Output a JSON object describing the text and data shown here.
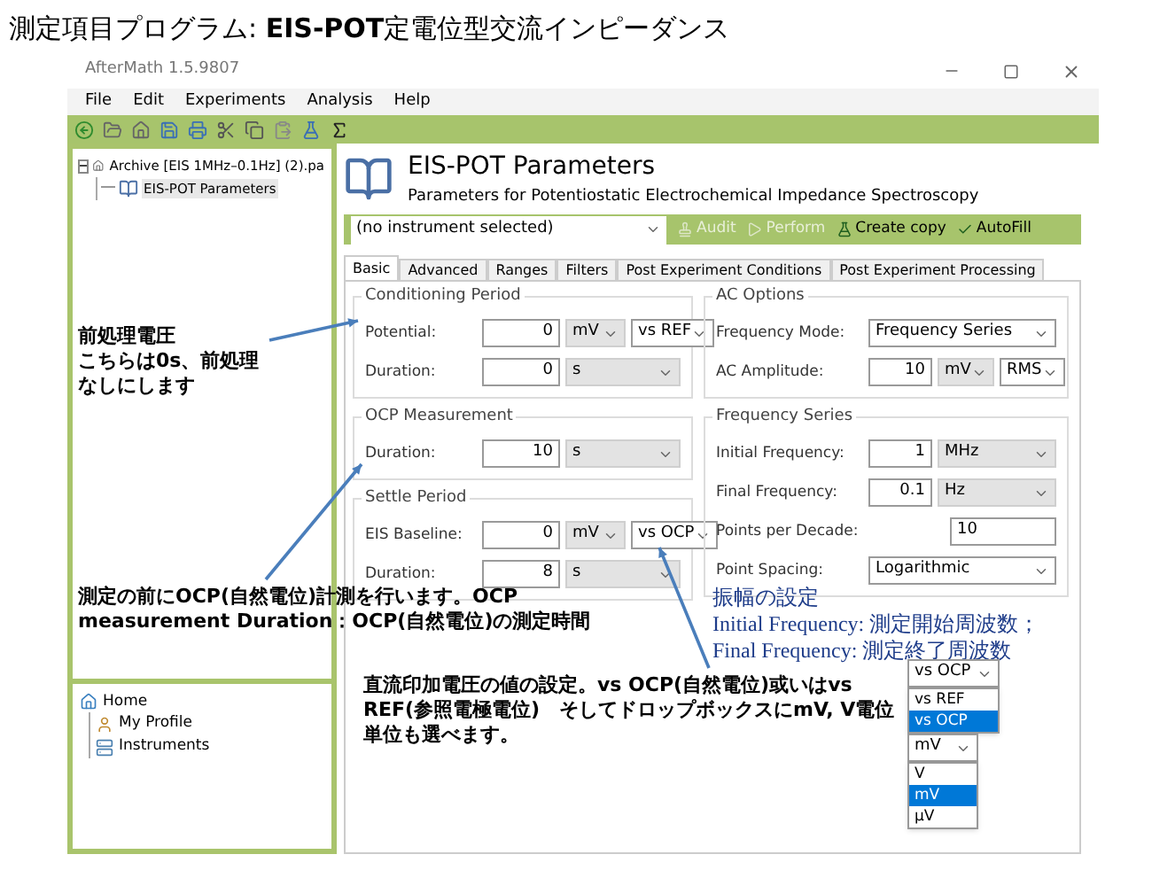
{
  "page_title": "測定項目プログラム: **EIS-POT**定電位型交流インピーダンス",
  "window": {
    "title": "AfterMath 1.5.9807"
  },
  "menu": [
    "File",
    "Edit",
    "Experiments",
    "Analysis",
    "Help"
  ],
  "tree": [
    {
      "label": "Archive [EIS 1MHz–0.1Hz] (2).pa",
      "expanded": true,
      "selected": false,
      "children": [
        {
          "label": "EIS-POT Parameters",
          "selected": true
        }
      ]
    }
  ],
  "nav_tree": [
    {
      "label": "Home",
      "children": [
        {
          "label": "My Profile"
        },
        {
          "label": "Instruments"
        }
      ]
    }
  ],
  "header": {
    "title": "EIS-POT Parameters",
    "subtitle": "Parameters for Potentiostatic Electrochemical Impedance Spectroscopy"
  },
  "instrument_select": {
    "value": "(no instrument selected)"
  },
  "actions": [
    {
      "label": "Audit",
      "disabled": true
    },
    {
      "label": "Perform",
      "disabled": true
    },
    {
      "label": "Create copy",
      "disabled": false
    },
    {
      "label": "AutoFill",
      "disabled": false
    }
  ],
  "tabs": [
    {
      "label": "Basic",
      "selected": true
    },
    {
      "label": "Advanced",
      "selected": false
    },
    {
      "label": "Ranges",
      "selected": false
    },
    {
      "label": "Filters",
      "selected": false
    },
    {
      "label": "Post Experiment Conditions",
      "selected": false
    },
    {
      "label": "Post Experiment Processing",
      "selected": false
    }
  ],
  "left_groups": [
    {
      "title": "Conditioning Period",
      "rows": [
        {
          "kind": "quantity",
          "label": "Potential:",
          "value": "0",
          "unit": "mV",
          "reference": "vs REF"
        },
        {
          "kind": "quantity",
          "label": "Duration:",
          "value": "0",
          "unit": "s"
        }
      ]
    },
    {
      "title": "OCP Measurement",
      "rows": [
        {
          "kind": "quantity",
          "label": "Duration:",
          "value": "10",
          "unit": "s"
        }
      ]
    },
    {
      "title": "Settle Period",
      "rows": [
        {
          "kind": "quantity",
          "label": "EIS Baseline:",
          "value": "0",
          "unit": "mV",
          "reference": "vs OCP"
        },
        {
          "kind": "quantity",
          "label": "Duration:",
          "value": "8",
          "unit": "s"
        }
      ]
    }
  ],
  "right_groups": [
    {
      "title": "AC Options",
      "rows": [
        {
          "kind": "choice",
          "label": "Frequency Mode:",
          "value": "Frequency Series"
        },
        {
          "kind": "quantity",
          "label": "AC Amplitude:",
          "value": "10",
          "unit": "mV",
          "reference": "RMS"
        }
      ]
    },
    {
      "title": "Frequency Series",
      "rows": [
        {
          "kind": "quantity",
          "label": "Initial Frequency:",
          "value": "1",
          "unit": "MHz"
        },
        {
          "kind": "quantity",
          "label": "Final Frequency:",
          "value": "0.1",
          "unit": "Hz"
        },
        {
          "kind": "number",
          "label": "Points per Decade:",
          "value": "10"
        },
        {
          "kind": "choice",
          "label": "Point Spacing:",
          "value": "Logarithmic"
        }
      ]
    }
  ],
  "notes": [
    {
      "lines": [
        "前処理電圧",
        "こちらは0s、前処理なしにします"
      ]
    },
    {
      "lines": [
        "測定の前にOCP(自然電位)計測を行います。OCP measurement Duration：OCP(自然電位)の測定時間"
      ]
    },
    {
      "lines": [
        "直流印加電圧の値の設定。vs OCP(自然電位)或いはvs REF(参照電極電位)　そしてドロップボックスにmV, V電位単位も選べます。"
      ]
    },
    {
      "lines": [
        "振幅の設定",
        "Initial Frequency: 測定開始周波数；",
        "Final Frequency: 測定終了周波数"
      ]
    }
  ],
  "dropdown_examples": [
    {
      "value": "vs OCP",
      "options": [
        {
          "label": "vs REF",
          "selected": false
        },
        {
          "label": "vs OCP",
          "selected": true
        }
      ]
    },
    {
      "value": "mV",
      "options": [
        {
          "label": "V",
          "selected": false
        },
        {
          "label": "mV",
          "selected": true
        },
        {
          "label": "μV",
          "selected": false
        }
      ]
    }
  ]
}
